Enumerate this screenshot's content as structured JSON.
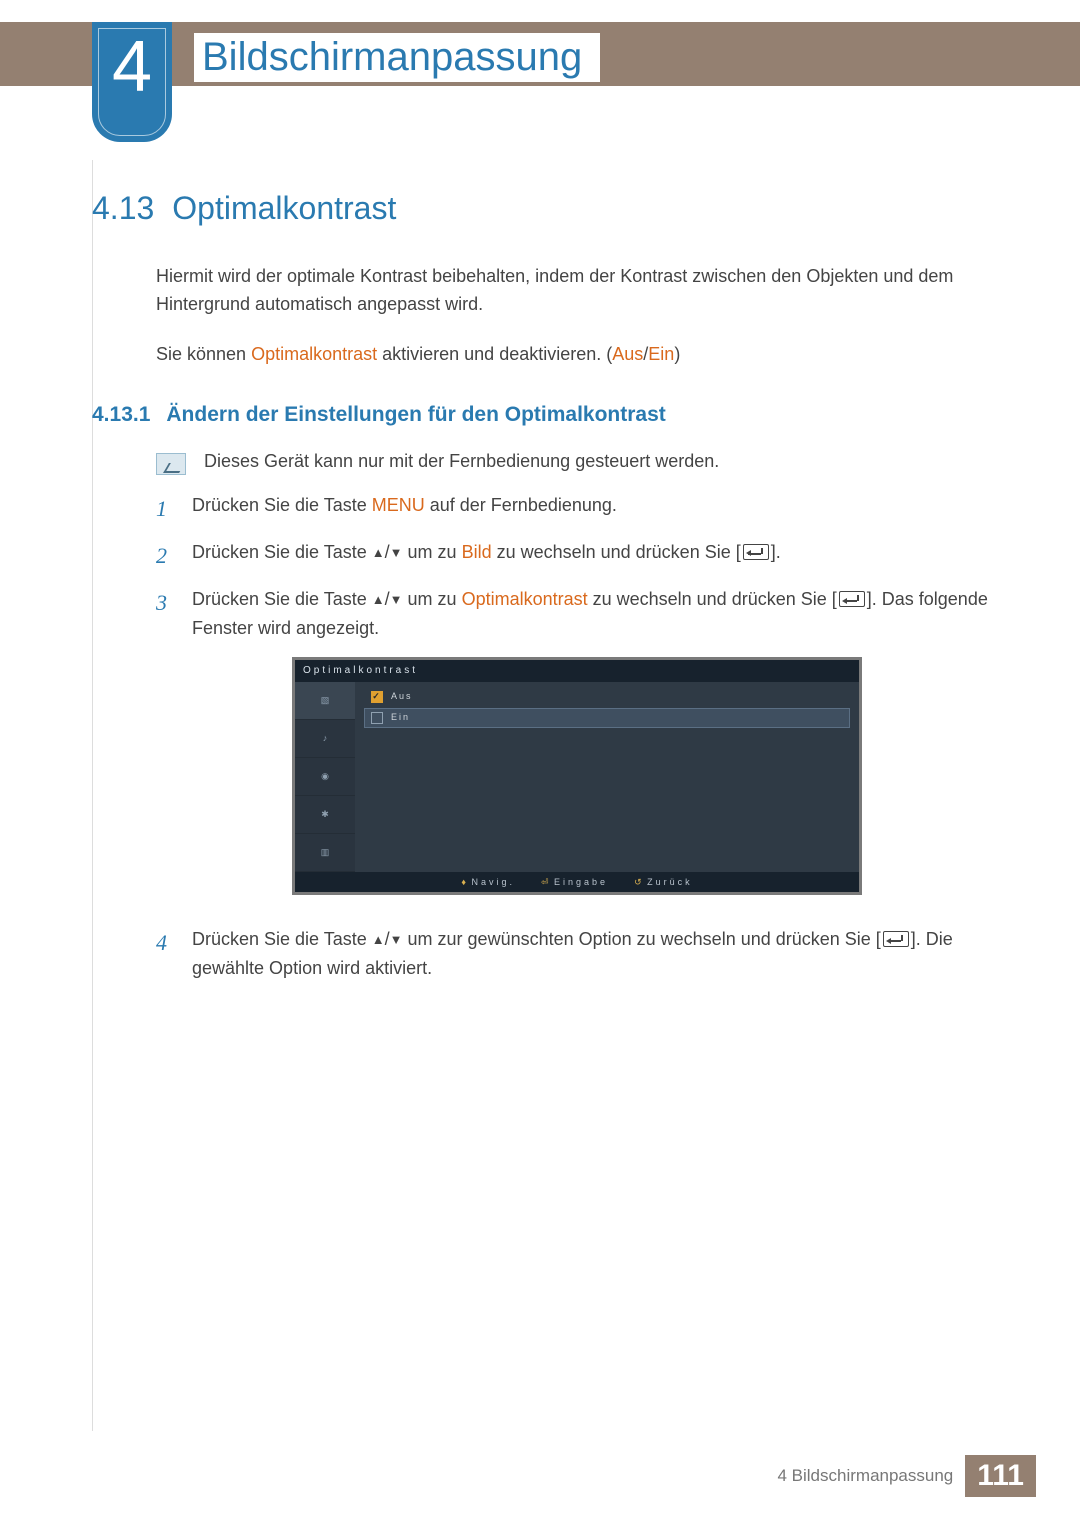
{
  "chapter": {
    "number": "4",
    "title": "Bildschirmanpassung"
  },
  "section": {
    "number": "4.13",
    "title": "Optimalkontrast"
  },
  "intro1": "Hiermit wird der optimale Kontrast beibehalten, indem der Kontrast zwischen den Objekten und dem Hintergrund automatisch angepasst wird.",
  "intro2_a": "Sie können ",
  "intro2_b": "Optimalkontrast",
  "intro2_c": " aktivieren und deaktivieren. (",
  "intro2_off": "Aus",
  "intro2_slash": "/",
  "intro2_on": "Ein",
  "intro2_end": ")",
  "subsection": {
    "number": "4.13.1",
    "title": "Ändern der Einstellungen für den Optimalkontrast"
  },
  "note": "Dieses Gerät kann nur mit der Fernbedienung gesteuert werden.",
  "steps": {
    "s1_a": "Drücken Sie die Taste ",
    "s1_menu": "MENU",
    "s1_b": " auf der Fernbedienung.",
    "s2_a": "Drücken Sie die Taste ",
    "s2_b": " um zu ",
    "s2_bild": "Bild",
    "s2_c": " zu wechseln und drücken Sie [",
    "s2_d": "].",
    "s3_a": "Drücken Sie die Taste ",
    "s3_b": " um zu ",
    "s3_opt": "Optimalkontrast",
    "s3_c": " zu wechseln und drücken Sie [",
    "s3_d": "]. Das folgende Fenster wird angezeigt.",
    "s4_a": "Drücken Sie die Taste ",
    "s4_b": " um zur gewünschten Option zu wechseln und drücken Sie [",
    "s4_c": "]. Die gewählte Option wird aktiviert."
  },
  "osd": {
    "title": "Optimalkontrast",
    "opt1": "Aus",
    "opt2": "Ein",
    "foot_move": "Navig.",
    "foot_enter": "Eingabe",
    "foot_return": "Zurück"
  },
  "footer": {
    "label": "4 Bildschirmanpassung",
    "page": "111"
  }
}
